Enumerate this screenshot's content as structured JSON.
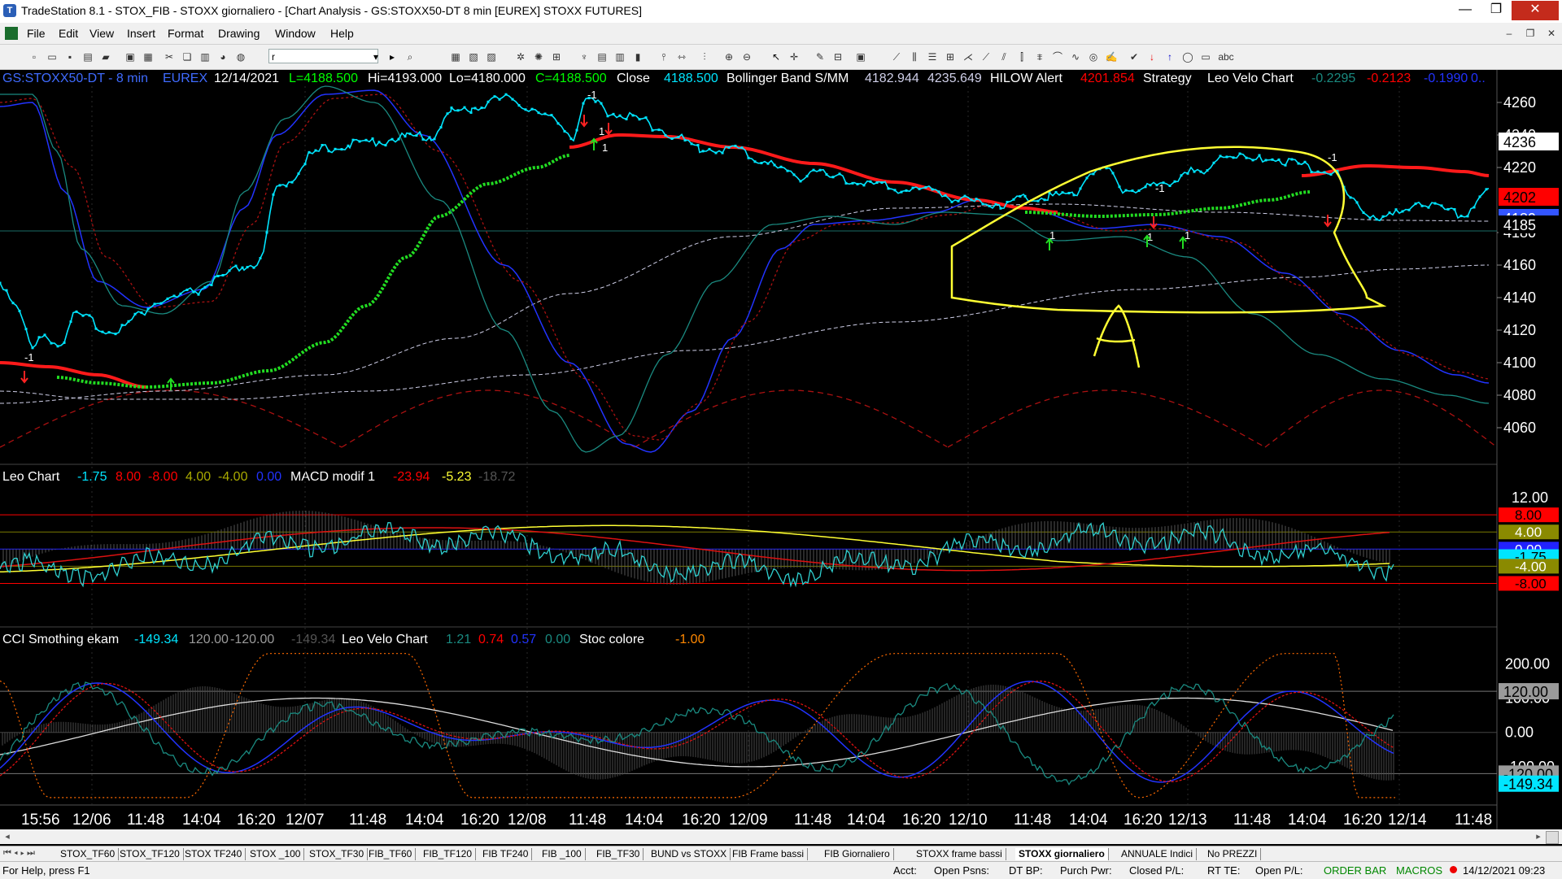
{
  "window": {
    "title": "TradeStation 8.1 - STOX_FIB - STOXX giornaliero - [Chart Analysis - GS:STOXX50-DT  8 min  [EUREX] STOXX FUTURES]",
    "minimize": "—",
    "maximize": "❐",
    "close": "✕"
  },
  "menu": [
    "File",
    "Edit",
    "View",
    "Insert",
    "Format",
    "Drawing",
    "Window",
    "Help"
  ],
  "toolbar": {
    "symbol_combo": "r"
  },
  "chart": {
    "status_line": {
      "symbol": "GS:STOXX50-DT - 8 min",
      "exchange": "EUREX",
      "date": "12/14/2021",
      "last": "L=4188.500",
      "hi": "Hi=4193.000",
      "lo": "Lo=4180.000",
      "close_c": "C=4188.500",
      "close_label": "Close",
      "close_val": "4188.500",
      "boll_label": "Bollinger Band S/MM",
      "boll_1": "4182.944",
      "boll_2": "4235.649",
      "hilow_label": "HILOW Alert",
      "hilow_val": "4201.854",
      "strategy_label": "Strategy",
      "leovelo_label": "Leo Velo Chart",
      "lv_1": "-0.2295",
      "lv_2": "-0.2123",
      "lv_3": "-0.1990",
      "lv_4": "0.."
    },
    "panel2_status": {
      "leo_label": "Leo Chart",
      "v1": "-1.75",
      "v2": "8.00",
      "v3": "-8.00",
      "v4": "4.00",
      "v5": "-4.00",
      "v6": "0.00",
      "macd_label": "MACD modif 1",
      "m1": "-23.94",
      "m2": "-5.23",
      "m3": "-18.72"
    },
    "panel3_status": {
      "cci_label": "CCI Smothing ekam",
      "c1": "-149.34",
      "c2": "120.00",
      "c3": "-120.00",
      "c4": "-149.34",
      "leovelo_label": "Leo Velo Chart",
      "l1": "1.21",
      "l2": "0.74",
      "l3": "0.57",
      "l4": "0.00",
      "stoc_label": "Stoc colore",
      "s1": "-1.00"
    },
    "price_axis": [
      "4260",
      "4240",
      "4220",
      "4180",
      "4160",
      "4140",
      "4120",
      "4100",
      "4080",
      "4060"
    ],
    "price_markers": [
      {
        "label": "4236",
        "bg": "#ffffff",
        "fg": "#000000"
      },
      {
        "label": "4202",
        "bg": "#ff0000",
        "fg": "#000000"
      },
      {
        "label": "4189",
        "bg": "#3355ff",
        "fg": "#ffffff"
      },
      {
        "label": "4185",
        "bg": "#000000",
        "fg": "#ffffff"
      }
    ],
    "panel2_axis": [
      "12.00"
    ],
    "panel2_markers": [
      {
        "label": "8.00",
        "bg": "#ff0000",
        "fg": "#000000"
      },
      {
        "label": "4.00",
        "bg": "#8a8a00",
        "fg": "#ffffff"
      },
      {
        "label": "0.00",
        "bg": "#2222ff",
        "fg": "#ffffff"
      },
      {
        "label": "-1.75",
        "bg": "#00e5ff",
        "fg": "#000000"
      },
      {
        "label": "-4.00",
        "bg": "#8a8a00",
        "fg": "#ffffff"
      },
      {
        "label": "-8.00",
        "bg": "#ff0000",
        "fg": "#000000"
      }
    ],
    "panel3_axis": [
      "200.00",
      "100.00",
      "0.00",
      "-100.00"
    ],
    "panel3_markers": [
      {
        "label": "120.00",
        "bg": "#9a9a9a",
        "fg": "#000000"
      },
      {
        "label": "-120.00",
        "bg": "#9a9a9a",
        "fg": "#000000"
      },
      {
        "label": "-149.34",
        "bg": "#00e5ff",
        "fg": "#000000"
      }
    ],
    "time_axis": [
      "15:56",
      "12/06",
      "11:48",
      "14:04",
      "16:20",
      "12/07",
      "11:48",
      "14:04",
      "16:20",
      "12/08",
      "11:48",
      "14:04",
      "16:20",
      "12/09",
      "11:48",
      "14:04",
      "16:20",
      "12/10",
      "11:48",
      "14:04",
      "16:20",
      "12/13",
      "11:48",
      "14:04",
      "16:20",
      "12/14",
      "11:48"
    ],
    "strategy_labels": [
      "-1",
      "-1",
      "-1",
      "-1",
      "1",
      "1",
      "1",
      "1",
      "1"
    ],
    "annotation_letter": "A"
  },
  "tabs": [
    "STOX_TF60",
    "STOX_TF120",
    "STOX TF240",
    "STOX _100",
    "STOX_TF30",
    "FIB_TF60",
    "FIB_TF120",
    "FIB TF240",
    "FIB _100",
    "FIB_TF30",
    "BUND vs STOXX",
    "FIB Frame bassi",
    "FIB Giornaliero",
    "STOXX frame bassi",
    "STOXX giornaliero",
    "ANNUALE Indici",
    "No PREZZI"
  ],
  "active_tab": "STOXX giornaliero",
  "status": {
    "help": "For Help, press F1",
    "acct": "Acct:",
    "open_psns": "Open Psns:",
    "dt_bp": "DT BP:",
    "purch_pwr": "Purch Pwr:",
    "closed_pl": "Closed P/L:",
    "rt_te": "RT TE:",
    "open_pl": "Open P/L:",
    "order_bar": "ORDER BAR",
    "macros": "MACROS",
    "datetime": "14/12/2021 09:23"
  },
  "colors": {
    "bg": "#000000",
    "price": "#00e5ff",
    "hilow_red": "#ff1a1a",
    "hilow_green": "#22dd22",
    "band_white": "#cfcfe8",
    "blue": "#2233ff",
    "teal": "#1a8a80",
    "dark_red": "#aa1111",
    "yellow": "#ffff33"
  }
}
